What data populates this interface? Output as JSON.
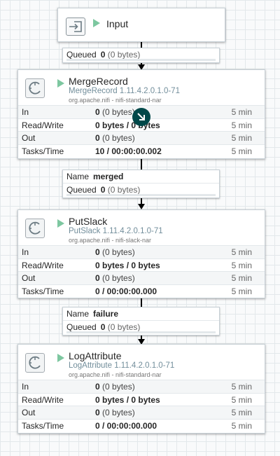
{
  "input_port": {
    "name": "Input"
  },
  "connection_1": {
    "queued_label": "Queued",
    "queued_count": "0",
    "queued_size": "(0 bytes)"
  },
  "connection_2": {
    "name_label": "Name",
    "name_value": "merged",
    "queued_label": "Queued",
    "queued_count": "0",
    "queued_size": "(0 bytes)"
  },
  "connection_3": {
    "name_label": "Name",
    "name_value": "failure",
    "queued_label": "Queued",
    "queued_count": "0",
    "queued_size": "(0 bytes)"
  },
  "stat_labels": {
    "in": "In",
    "read_write": "Read/Write",
    "out": "Out",
    "tasks_time": "Tasks/Time",
    "window": "5 min"
  },
  "processors": [
    {
      "name": "MergeRecord",
      "type": "MergeRecord 1.11.4.2.0.1.0-71",
      "bundle": "org.apache.nifi - nifi-standard-nar",
      "in_count": "0",
      "in_size": "(0 bytes)",
      "read_write": "0 bytes / 0 bytes",
      "out_count": "0",
      "out_size": "(0 bytes)",
      "tasks_time": "10 / 00:00:00.002"
    },
    {
      "name": "PutSlack",
      "type": "PutSlack 1.11.4.2.0.1.0-71",
      "bundle": "org.apache.nifi - nifi-slack-nar",
      "in_count": "0",
      "in_size": "(0 bytes)",
      "read_write": "0 bytes / 0 bytes",
      "out_count": "0",
      "out_size": "(0 bytes)",
      "tasks_time": "0 / 00:00:00.000"
    },
    {
      "name": "LogAttribute",
      "type": "LogAttribute 1.11.4.2.0.1.0-71",
      "bundle": "org.apache.nifi - nifi-standard-nar",
      "in_count": "0",
      "in_size": "(0 bytes)",
      "read_write": "0 bytes / 0 bytes",
      "out_count": "0",
      "out_size": "(0 bytes)",
      "tasks_time": "0 / 00:00:00.000"
    }
  ],
  "icons": {
    "input_port": "input-port-icon",
    "run_status": "play-icon",
    "processor": "processor-icon",
    "bulletin": "upstream-arrow-badge-icon"
  },
  "colors": {
    "running": "#7dc7a0",
    "processor_type": "#728e9b",
    "badge": "#004849"
  }
}
